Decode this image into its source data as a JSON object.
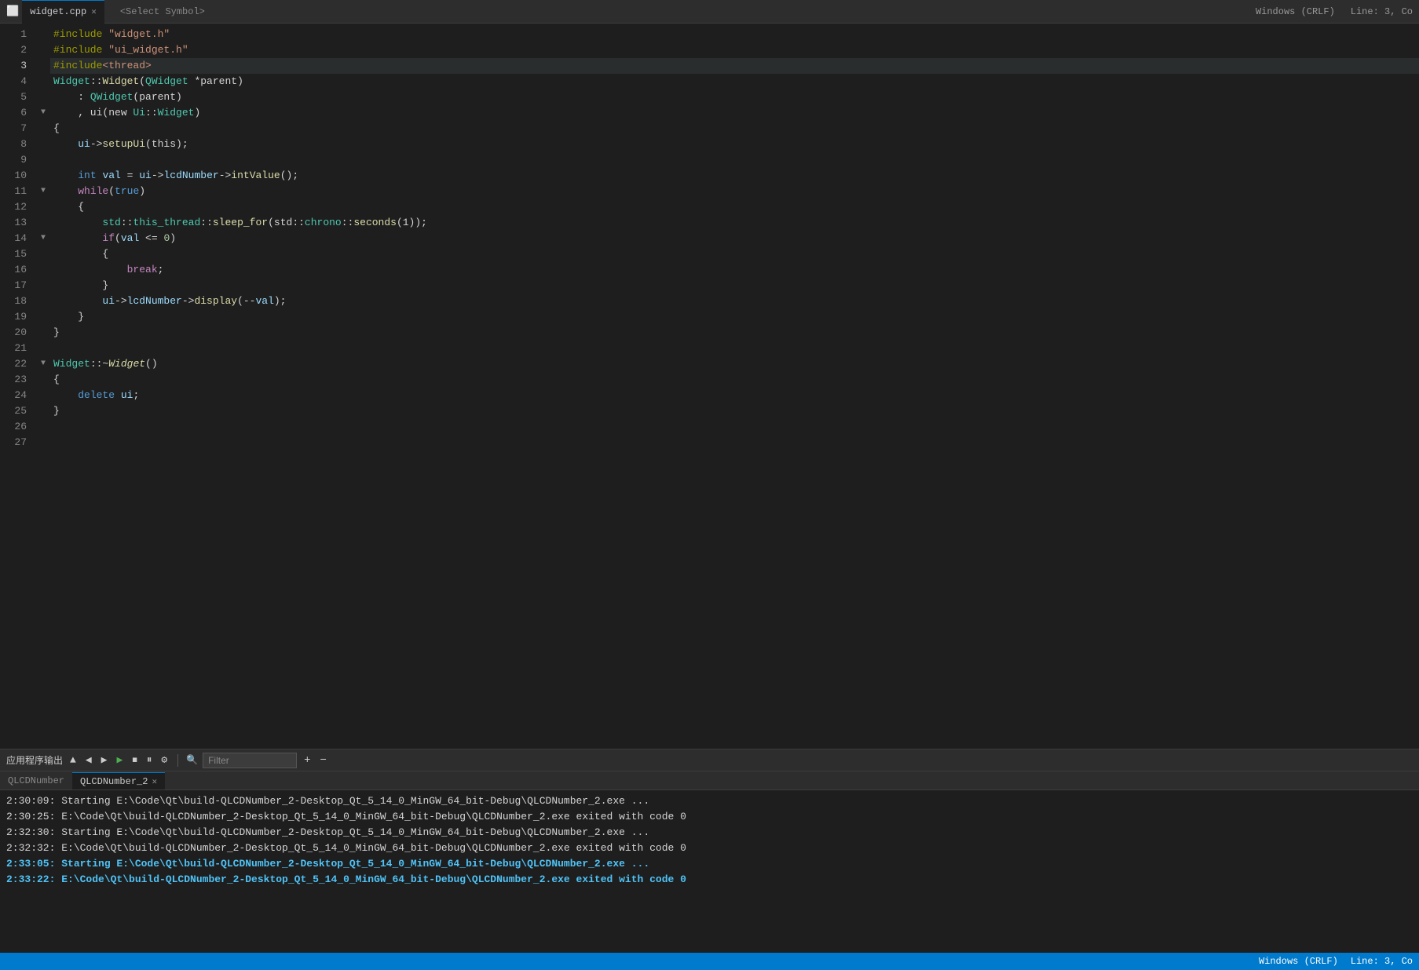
{
  "titlebar": {
    "tab_file": "widget.cpp",
    "tab_symbol": "<Select Symbol>",
    "encoding": "Windows (CRLF)",
    "cursor_pos": "Line: 3, Co"
  },
  "editor": {
    "lines": [
      {
        "num": 1,
        "fold": "",
        "content": [
          {
            "t": "#include ",
            "c": "pp"
          },
          {
            "t": "\"widget.h\"",
            "c": "inc"
          }
        ]
      },
      {
        "num": 2,
        "fold": "",
        "content": [
          {
            "t": "#include ",
            "c": "pp"
          },
          {
            "t": "\"ui_widget.h\"",
            "c": "inc"
          }
        ]
      },
      {
        "num": 3,
        "fold": "",
        "content": [
          {
            "t": "#include",
            "c": "pp"
          },
          {
            "t": "<thread>",
            "c": "inc"
          }
        ],
        "active": true
      },
      {
        "num": 4,
        "fold": "",
        "content": [
          {
            "t": "Widget",
            "c": "ns"
          },
          {
            "t": "::",
            "c": "op"
          },
          {
            "t": "Widget",
            "c": "fn"
          },
          {
            "t": "(",
            "c": "op"
          },
          {
            "t": "QWidget",
            "c": "ns"
          },
          {
            "t": " *parent)",
            "c": "op"
          }
        ]
      },
      {
        "num": 5,
        "fold": "",
        "content": [
          {
            "t": "    : ",
            "c": "op"
          },
          {
            "t": "QWidget",
            "c": "ns"
          },
          {
            "t": "(parent)",
            "c": "op"
          }
        ]
      },
      {
        "num": 6,
        "fold": "▼",
        "content": [
          {
            "t": "    , ui(new ",
            "c": "op"
          },
          {
            "t": "Ui",
            "c": "ns"
          },
          {
            "t": "::",
            "c": "op"
          },
          {
            "t": "Widget",
            "c": "ns"
          },
          {
            "t": ")",
            "c": "op"
          }
        ]
      },
      {
        "num": 7,
        "fold": "",
        "content": [
          {
            "t": "{",
            "c": "op"
          }
        ]
      },
      {
        "num": 8,
        "fold": "",
        "content": [
          {
            "t": "    ui",
            "c": "var"
          },
          {
            "t": "->",
            "c": "arrow"
          },
          {
            "t": "setupUi",
            "c": "fn"
          },
          {
            "t": "(this);",
            "c": "op"
          }
        ]
      },
      {
        "num": 9,
        "fold": "",
        "content": []
      },
      {
        "num": 10,
        "fold": "",
        "content": [
          {
            "t": "    ",
            "c": "op"
          },
          {
            "t": "int",
            "c": "kw"
          },
          {
            "t": " ",
            "c": "op"
          },
          {
            "t": "val",
            "c": "var"
          },
          {
            "t": " = ",
            "c": "op"
          },
          {
            "t": "ui",
            "c": "var"
          },
          {
            "t": "->",
            "c": "arrow"
          },
          {
            "t": "lcdNumber",
            "c": "var"
          },
          {
            "t": "->",
            "c": "arrow"
          },
          {
            "t": "intValue",
            "c": "fn"
          },
          {
            "t": "();",
            "c": "op"
          }
        ]
      },
      {
        "num": 11,
        "fold": "▼",
        "content": [
          {
            "t": "    ",
            "c": "op"
          },
          {
            "t": "while",
            "c": "kw2"
          },
          {
            "t": "(",
            "c": "op"
          },
          {
            "t": "true",
            "c": "kw"
          },
          {
            "t": ")",
            "c": "op"
          }
        ]
      },
      {
        "num": 12,
        "fold": "",
        "content": [
          {
            "t": "    {",
            "c": "op"
          }
        ]
      },
      {
        "num": 13,
        "fold": "",
        "content": [
          {
            "t": "        std",
            "c": "ns"
          },
          {
            "t": "::",
            "c": "op"
          },
          {
            "t": "this_thread",
            "c": "ns"
          },
          {
            "t": "::",
            "c": "op"
          },
          {
            "t": "sleep_for",
            "c": "fn"
          },
          {
            "t": "(std",
            "c": "op"
          },
          {
            "t": "::",
            "c": "op"
          },
          {
            "t": "chrono",
            "c": "ns"
          },
          {
            "t": "::",
            "c": "op"
          },
          {
            "t": "seconds",
            "c": "fn"
          },
          {
            "t": "(1));",
            "c": "op"
          }
        ]
      },
      {
        "num": 14,
        "fold": "▼",
        "content": [
          {
            "t": "        ",
            "c": "op"
          },
          {
            "t": "if",
            "c": "kw2"
          },
          {
            "t": "(",
            "c": "op"
          },
          {
            "t": "val",
            "c": "var"
          },
          {
            "t": " <= ",
            "c": "op"
          },
          {
            "t": "0",
            "c": "num"
          },
          {
            "t": ")",
            "c": "op"
          }
        ]
      },
      {
        "num": 15,
        "fold": "",
        "content": [
          {
            "t": "        {",
            "c": "op"
          }
        ]
      },
      {
        "num": 16,
        "fold": "",
        "content": [
          {
            "t": "            ",
            "c": "op"
          },
          {
            "t": "break",
            "c": "kw2"
          },
          {
            "t": ";",
            "c": "op"
          }
        ]
      },
      {
        "num": 17,
        "fold": "",
        "content": [
          {
            "t": "        }",
            "c": "op"
          }
        ]
      },
      {
        "num": 18,
        "fold": "",
        "content": [
          {
            "t": "        ui",
            "c": "var"
          },
          {
            "t": "->",
            "c": "arrow"
          },
          {
            "t": "lcdNumber",
            "c": "var"
          },
          {
            "t": "->",
            "c": "arrow"
          },
          {
            "t": "display",
            "c": "fn"
          },
          {
            "t": "(--",
            "c": "op"
          },
          {
            "t": "val",
            "c": "var"
          },
          {
            "t": ");",
            "c": "op"
          }
        ]
      },
      {
        "num": 19,
        "fold": "",
        "content": [
          {
            "t": "    }",
            "c": "op"
          }
        ]
      },
      {
        "num": 20,
        "fold": "",
        "content": [
          {
            "t": "}",
            "c": "op"
          }
        ]
      },
      {
        "num": 21,
        "fold": "",
        "content": []
      },
      {
        "num": 22,
        "fold": "▼",
        "content": [
          {
            "t": "Widget",
            "c": "ns"
          },
          {
            "t": "::",
            "c": "op"
          },
          {
            "t": "~",
            "c": "op"
          },
          {
            "t": "Widget",
            "c": "fn italic"
          },
          {
            "t": "()",
            "c": "op"
          }
        ]
      },
      {
        "num": 23,
        "fold": "",
        "content": [
          {
            "t": "{",
            "c": "op"
          }
        ]
      },
      {
        "num": 24,
        "fold": "",
        "content": [
          {
            "t": "    ",
            "c": "op"
          },
          {
            "t": "delete",
            "c": "kw"
          },
          {
            "t": " ",
            "c": "op"
          },
          {
            "t": "ui",
            "c": "var"
          },
          {
            "t": ";",
            "c": "op"
          }
        ]
      },
      {
        "num": 25,
        "fold": "",
        "content": [
          {
            "t": "}",
            "c": "op"
          }
        ]
      },
      {
        "num": 26,
        "fold": "",
        "content": []
      },
      {
        "num": 27,
        "fold": "",
        "content": []
      }
    ]
  },
  "output_panel": {
    "toolbar_label": "应用程序输出",
    "filter_placeholder": "Filter",
    "tabs": [
      {
        "label": "QLCDNumber",
        "active": false,
        "closeable": false
      },
      {
        "label": "QLCDNumber_2",
        "active": true,
        "closeable": true
      }
    ],
    "lines": [
      {
        "text": "2:30:09: Starting E:\\Code\\Qt\\build-QLCDNumber_2-Desktop_Qt_5_14_0_MinGW_64_bit-Debug\\QLCDNumber_2.exe ...",
        "style": "normal"
      },
      {
        "text": "2:30:25: E:\\Code\\Qt\\build-QLCDNumber_2-Desktop_Qt_5_14_0_MinGW_64_bit-Debug\\QLCDNumber_2.exe exited with code 0",
        "style": "normal"
      },
      {
        "text": "",
        "style": "normal"
      },
      {
        "text": "2:32:30: Starting E:\\Code\\Qt\\build-QLCDNumber_2-Desktop_Qt_5_14_0_MinGW_64_bit-Debug\\QLCDNumber_2.exe ...",
        "style": "normal"
      },
      {
        "text": "2:32:32: E:\\Code\\Qt\\build-QLCDNumber_2-Desktop_Qt_5_14_0_MinGW_64_bit-Debug\\QLCDNumber_2.exe exited with code 0",
        "style": "normal"
      },
      {
        "text": "",
        "style": "normal"
      },
      {
        "text": "2:33:05: Starting E:\\Code\\Qt\\build-QLCDNumber_2-Desktop_Qt_5_14_0_MinGW_64_bit-Debug\\QLCDNumber_2.exe ...",
        "style": "bold"
      },
      {
        "text": "2:33:22: E:\\Code\\Qt\\build-QLCDNumber_2-Desktop_Qt_5_14_0_MinGW_64_bit-Debug\\QLCDNumber_2.exe exited with code 0",
        "style": "bold"
      }
    ]
  },
  "statusbar": {
    "encoding": "Windows (CRLF)",
    "line_col": "Line: 3, Co"
  }
}
